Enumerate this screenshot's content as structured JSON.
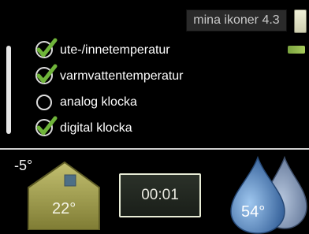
{
  "header": {
    "title": "mina ikoner 4.3"
  },
  "options": [
    {
      "label": "ute-/innetemperatur",
      "checked": true
    },
    {
      "label": "varmvattentemperatur",
      "checked": true
    },
    {
      "label": "analog klocka",
      "checked": false
    },
    {
      "label": "digital klocka",
      "checked": true
    }
  ],
  "status": {
    "outdoor_temp": "-5°",
    "indoor_temp": "22°",
    "clock": "00:01",
    "hot_water_temp": "54°"
  },
  "colors": {
    "check_green": "#6fb43a",
    "house_fill": "#a7a455",
    "drop_blue": "#4f7db6"
  }
}
